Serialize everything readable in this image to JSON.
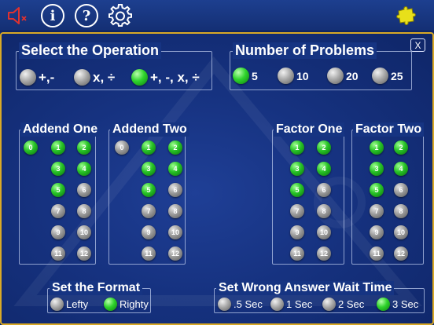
{
  "topbar": {
    "icons": [
      {
        "name": "speaker-muted-icon"
      },
      {
        "name": "info-icon",
        "glyph": "i"
      },
      {
        "name": "help-icon",
        "glyph": "?"
      },
      {
        "name": "gear-icon"
      },
      {
        "name": "puzzle-piece-icon"
      }
    ]
  },
  "colors": {
    "accent_gold": "#d9a926",
    "background": "#163280",
    "selected": "#2fd42c",
    "unselected": "#a9a9a9"
  },
  "close_label": "X",
  "operation": {
    "title": "Select the Operation",
    "options": [
      {
        "label": "+,-",
        "selected": false
      },
      {
        "label": "x, ÷",
        "selected": false
      },
      {
        "label": "+, -, x, ÷",
        "selected": true
      }
    ]
  },
  "problems": {
    "title": "Number of  Problems",
    "options": [
      {
        "label": "5",
        "selected": true
      },
      {
        "label": "10",
        "selected": false
      },
      {
        "label": "20",
        "selected": false
      },
      {
        "label": "25",
        "selected": false
      }
    ]
  },
  "groups": [
    {
      "title": "Addend One",
      "items": [
        {
          "label": "0",
          "selected": true
        },
        {
          "label": "1",
          "selected": true
        },
        {
          "label": "2",
          "selected": true
        },
        {
          "label": "3",
          "selected": true
        },
        {
          "label": "4",
          "selected": true
        },
        {
          "label": "5",
          "selected": true
        },
        {
          "label": "6",
          "selected": false
        },
        {
          "label": "7",
          "selected": false
        },
        {
          "label": "8",
          "selected": false
        },
        {
          "label": "9",
          "selected": false
        },
        {
          "label": "10",
          "selected": false
        },
        {
          "label": "11",
          "selected": false
        },
        {
          "label": "12",
          "selected": false
        }
      ]
    },
    {
      "title": "Addend Two",
      "items": [
        {
          "label": "0",
          "selected": false
        },
        {
          "label": "1",
          "selected": true
        },
        {
          "label": "2",
          "selected": true
        },
        {
          "label": "3",
          "selected": true
        },
        {
          "label": "4",
          "selected": true
        },
        {
          "label": "5",
          "selected": true
        },
        {
          "label": "6",
          "selected": false
        },
        {
          "label": "7",
          "selected": false
        },
        {
          "label": "8",
          "selected": false
        },
        {
          "label": "9",
          "selected": false
        },
        {
          "label": "10",
          "selected": false
        },
        {
          "label": "11",
          "selected": false
        },
        {
          "label": "12",
          "selected": false
        }
      ]
    },
    {
      "title": "Factor One",
      "items": [
        {
          "label": "1",
          "selected": true
        },
        {
          "label": "2",
          "selected": true
        },
        {
          "label": "3",
          "selected": true
        },
        {
          "label": "4",
          "selected": true
        },
        {
          "label": "5",
          "selected": true
        },
        {
          "label": "6",
          "selected": false
        },
        {
          "label": "7",
          "selected": false
        },
        {
          "label": "8",
          "selected": false
        },
        {
          "label": "9",
          "selected": false
        },
        {
          "label": "10",
          "selected": false
        },
        {
          "label": "11",
          "selected": false
        },
        {
          "label": "12",
          "selected": false
        }
      ]
    },
    {
      "title": "Factor Two",
      "items": [
        {
          "label": "1",
          "selected": true
        },
        {
          "label": "2",
          "selected": true
        },
        {
          "label": "3",
          "selected": true
        },
        {
          "label": "4",
          "selected": true
        },
        {
          "label": "5",
          "selected": true
        },
        {
          "label": "6",
          "selected": false
        },
        {
          "label": "7",
          "selected": false
        },
        {
          "label": "8",
          "selected": false
        },
        {
          "label": "9",
          "selected": false
        },
        {
          "label": "10",
          "selected": false
        },
        {
          "label": "11",
          "selected": false
        },
        {
          "label": "12",
          "selected": false
        }
      ]
    }
  ],
  "format": {
    "title": "Set the Format",
    "options": [
      {
        "label": "Lefty",
        "selected": false
      },
      {
        "label": "Righty",
        "selected": true
      }
    ]
  },
  "wait_time": {
    "title": "Set Wrong Answer Wait Time",
    "options": [
      {
        "label": ".5 Sec",
        "selected": false
      },
      {
        "label": "1 Sec",
        "selected": false
      },
      {
        "label": "2 Sec",
        "selected": false
      },
      {
        "label": "3 Sec",
        "selected": true
      }
    ]
  }
}
